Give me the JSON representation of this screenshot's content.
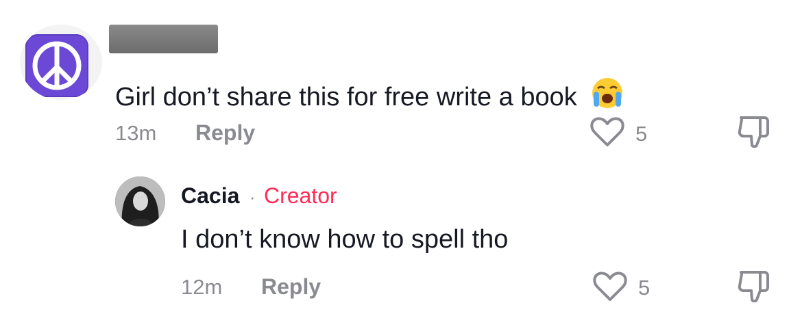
{
  "comments": [
    {
      "avatar_icon": "peace-sign-icon",
      "text": "Girl don’t share this for free write a book",
      "emoji": "😭",
      "emoji_name": "loudly-crying-face-icon",
      "time": "13m",
      "reply_label": "Reply",
      "likes": "5"
    },
    {
      "username": "Cacia",
      "separator": "·",
      "badge": "Creator",
      "text": "I don’t know how to spell tho",
      "time": "12m",
      "reply_label": "Reply",
      "likes": "5"
    }
  ],
  "colors": {
    "text": "#161823",
    "muted": "#8a8b91",
    "creator": "#fe2c55",
    "peace_tile": "#6b49d6"
  }
}
